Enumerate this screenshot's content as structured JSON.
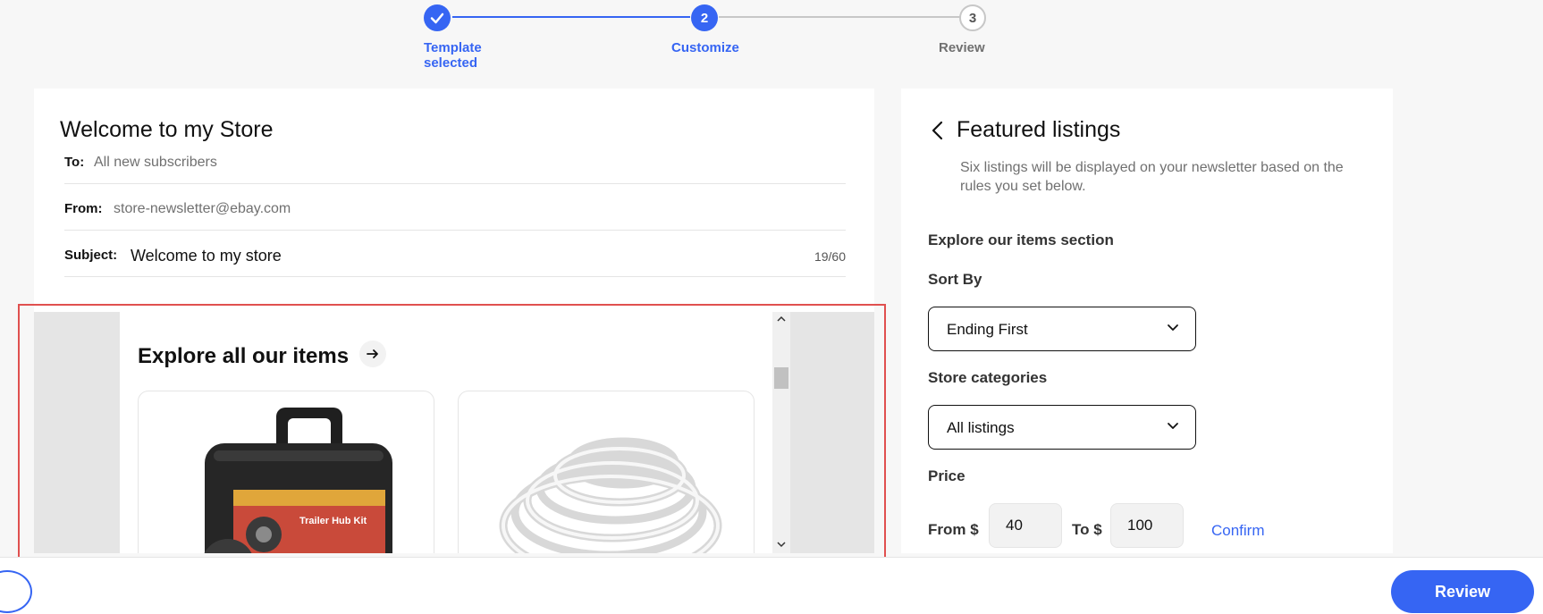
{
  "stepper": {
    "steps": [
      {
        "number": "1",
        "label": "Template selected",
        "status": "complete",
        "icon": "check-icon"
      },
      {
        "number": "2",
        "label": "Customize",
        "status": "active"
      },
      {
        "number": "3",
        "label": "Review",
        "status": "upcoming"
      }
    ]
  },
  "email": {
    "title": "Welcome to my Store",
    "to_label": "To:",
    "to_value": "All new subscribers",
    "from_label": "From:",
    "from_value": "store-newsletter@ebay.com",
    "subject_label": "Subject:",
    "subject_value": "Welcome to my store",
    "subject_count": "19/60"
  },
  "preview": {
    "section_title": "Explore all our items",
    "arrow_icon": "arrow-right-icon",
    "products": [
      {
        "image": "trailer-hub-kit-case",
        "box_text": "Trailer Hub Kit"
      },
      {
        "image": "coiled-white-trim"
      }
    ]
  },
  "panel": {
    "title": "Featured listings",
    "description": "Six listings will be displayed on your newsletter based on the rules you set below.",
    "section_title": "Explore our items section",
    "sort_label": "Sort By",
    "sort_value": "Ending First",
    "categories_label": "Store categories",
    "categories_value": "All listings",
    "price_label": "Price",
    "from_label": "From $",
    "from_value": "40",
    "to_label": "To $",
    "to_value": "100",
    "confirm_label": "Confirm"
  },
  "footer": {
    "review_label": "Review"
  },
  "colors": {
    "accent": "#3665f3",
    "highlight": "#e0504f",
    "muted_text": "#707070"
  }
}
